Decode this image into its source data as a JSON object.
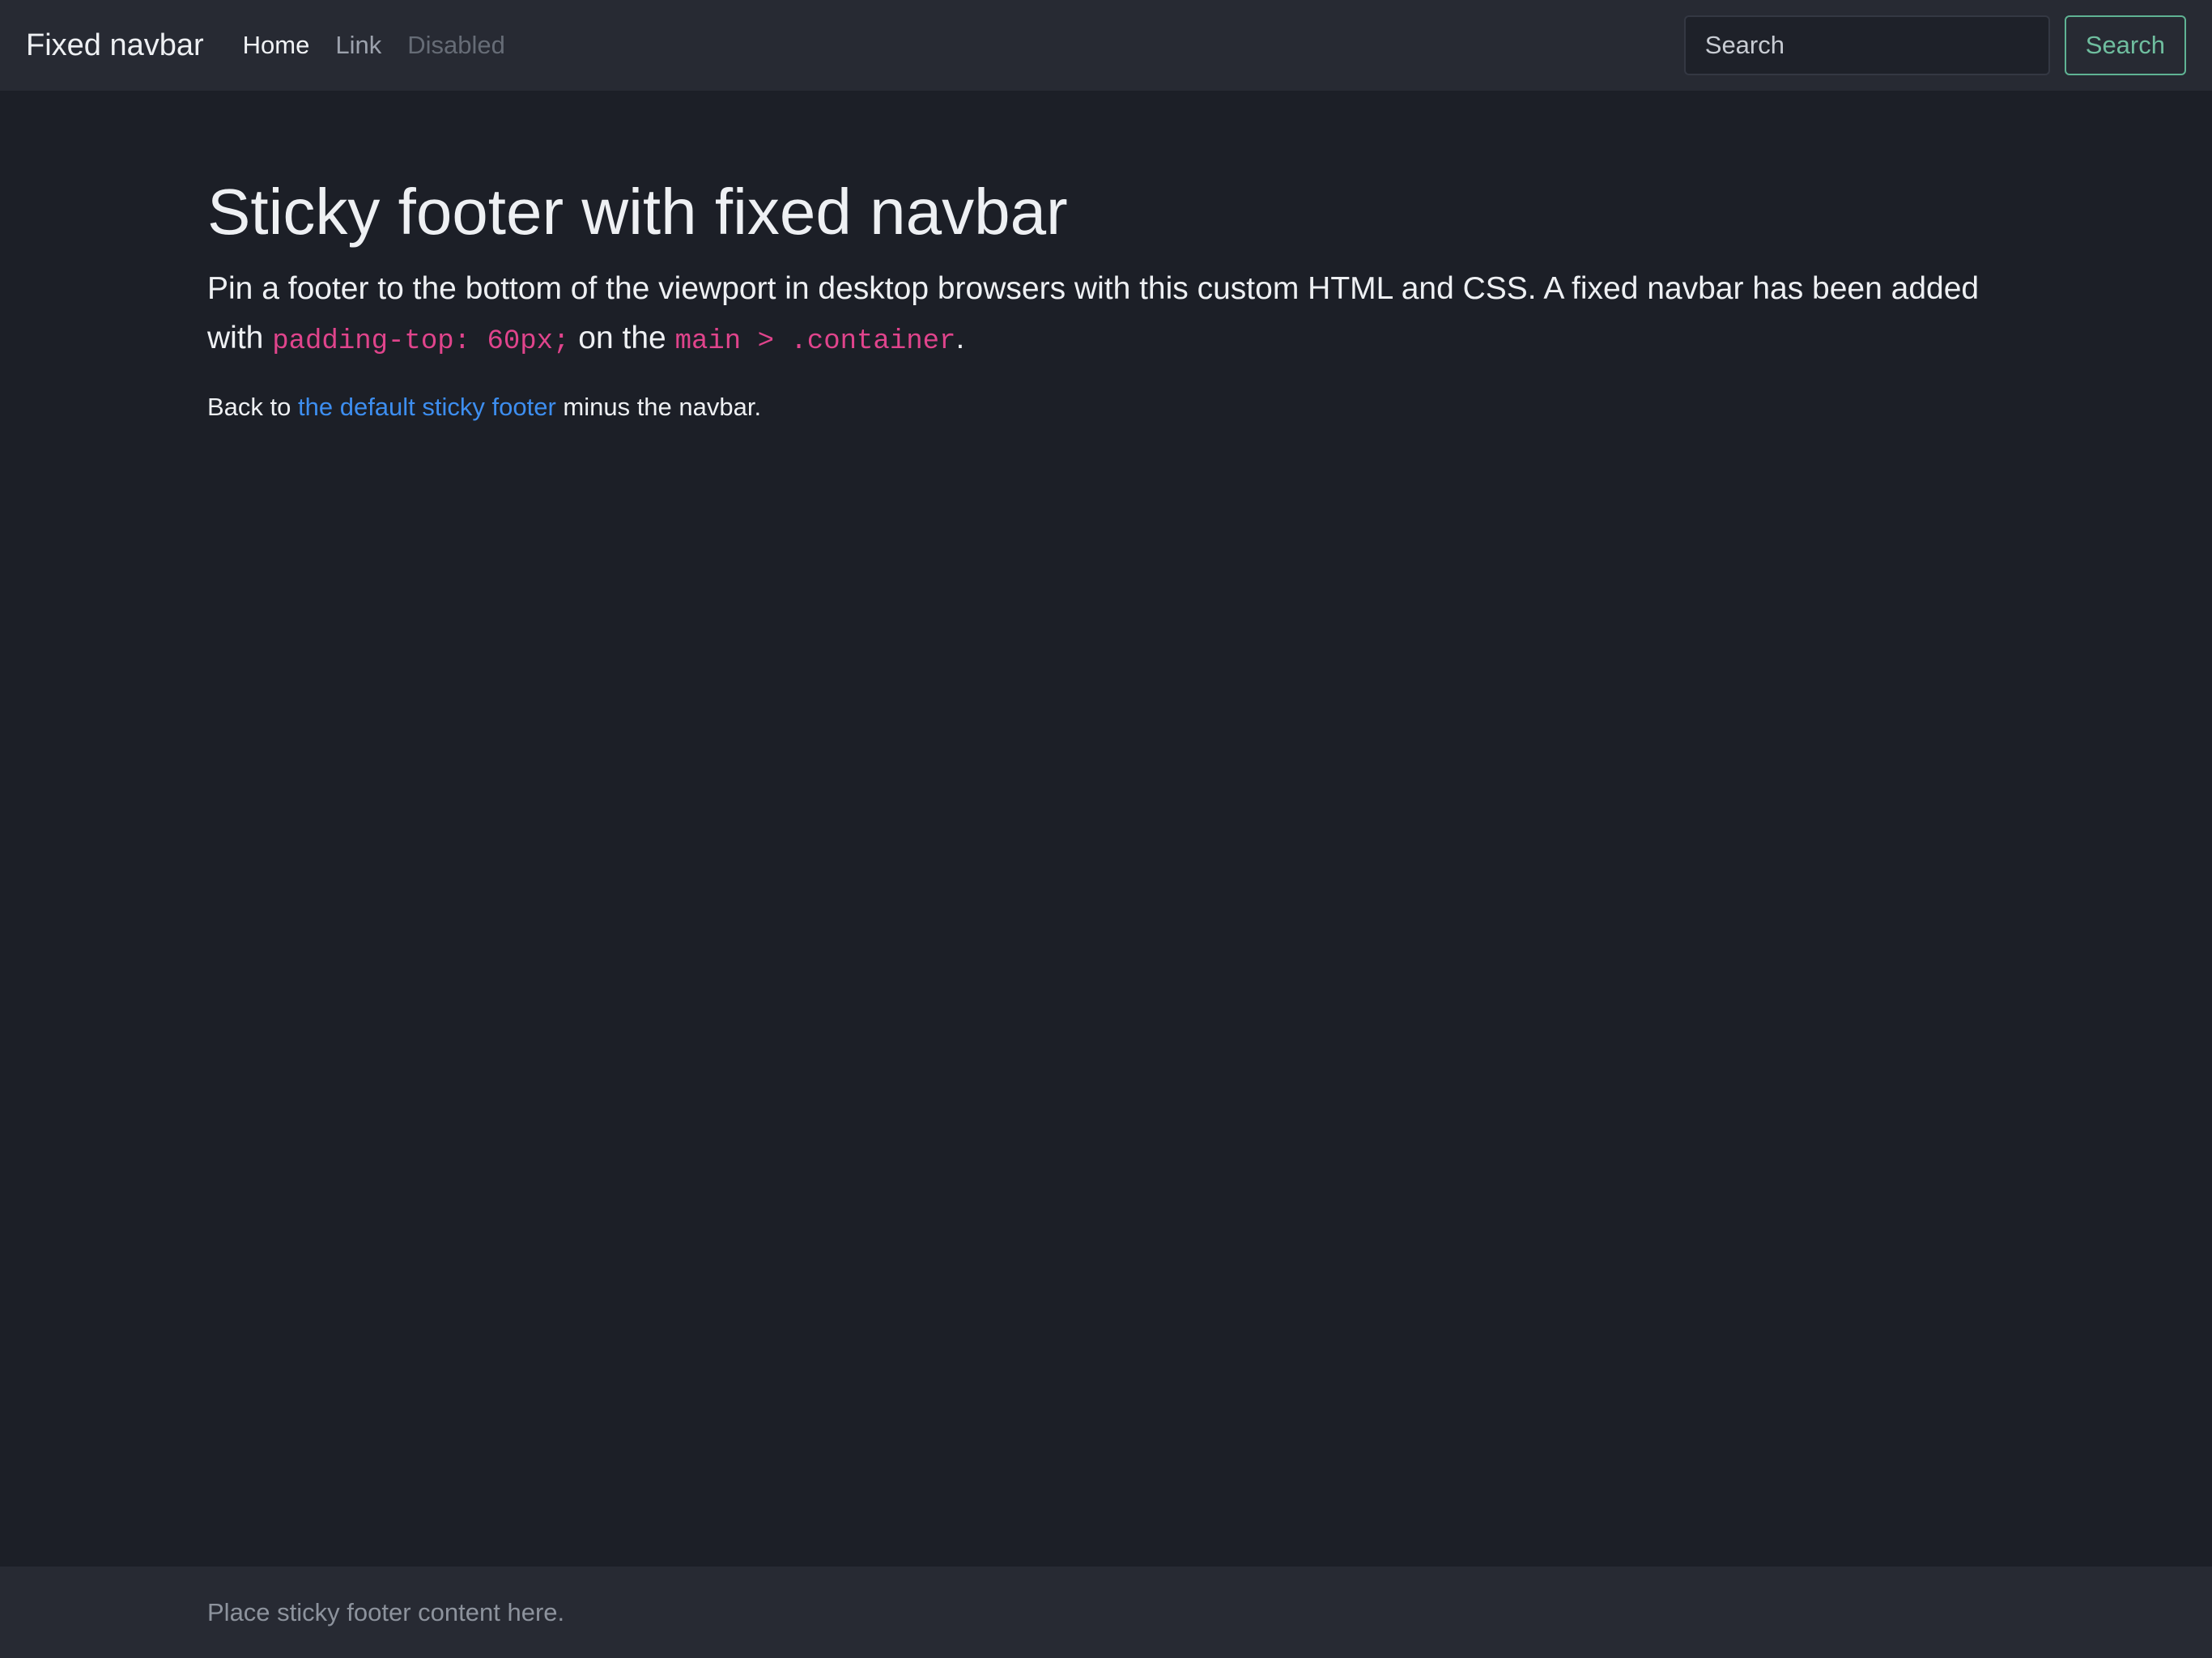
{
  "navbar": {
    "brand": "Fixed navbar",
    "links": [
      {
        "label": "Home",
        "state": "active"
      },
      {
        "label": "Link",
        "state": "normal"
      },
      {
        "label": "Disabled",
        "state": "disabled"
      }
    ],
    "search": {
      "placeholder": "Search",
      "button_label": "Search"
    }
  },
  "main": {
    "title": "Sticky footer with fixed navbar",
    "lead": {
      "part1": "Pin a footer to the bottom of the viewport in desktop browsers with this custom HTML and CSS. A fixed navbar has been added with ",
      "code1": "padding-top: 60px;",
      "part2": " on the ",
      "code2": "main > .container",
      "part3": "."
    },
    "back": {
      "prefix": "Back to ",
      "link_text": "the default sticky footer",
      "suffix": " minus the navbar."
    }
  },
  "footer": {
    "text": "Place sticky footer content here."
  },
  "colors": {
    "background": "#1c1f27",
    "navbar": "#272a33",
    "code": "#e0448c",
    "link": "#3d8ef0",
    "success_outline": "#5fb394"
  }
}
